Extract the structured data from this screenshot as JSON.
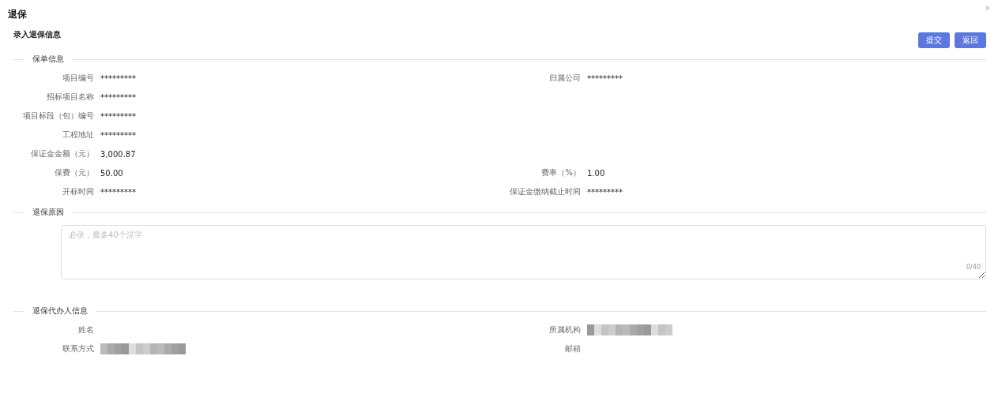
{
  "dialog": {
    "title": "退保",
    "close": "×"
  },
  "subtitle": "录入退保信息",
  "buttons": [
    {
      "label": "提交"
    },
    {
      "label": "返回"
    }
  ],
  "sections": [
    {
      "kind": "fields",
      "title": "保单信息",
      "rows": [
        [
          {
            "label": "项目编号",
            "value": "*********"
          },
          {
            "label": "归属公司",
            "value": "*********"
          }
        ],
        [
          {
            "label": "招标项目名称",
            "value": "*********"
          }
        ],
        [
          {
            "label": "项目标段（包）编号",
            "value": "*********"
          }
        ],
        [
          {
            "label": "工程地址",
            "value": "*********"
          }
        ],
        [
          {
            "label": "保证金金额（元）",
            "value": "3,000.87"
          }
        ],
        [
          {
            "label": "保费（元）",
            "value": "50.00"
          },
          {
            "label": "费率（%）",
            "value": "1.00"
          }
        ],
        [
          {
            "label": "开标时间",
            "value": "*********"
          },
          {
            "label": "保证金缴纳截止时间",
            "value": "*********"
          }
        ]
      ]
    },
    {
      "kind": "textarea",
      "title": "退保原因",
      "placeholder": "必录，最多40个汉字",
      "counter": "0/40"
    },
    {
      "kind": "fields",
      "title": "退保代办人信息",
      "rows": [
        [
          {
            "label": "姓名"
          },
          {
            "label": "所属机构",
            "redacted": true
          }
        ],
        [
          {
            "label": "联系方式",
            "redacted": true
          },
          {
            "label": "邮箱"
          }
        ]
      ]
    }
  ]
}
